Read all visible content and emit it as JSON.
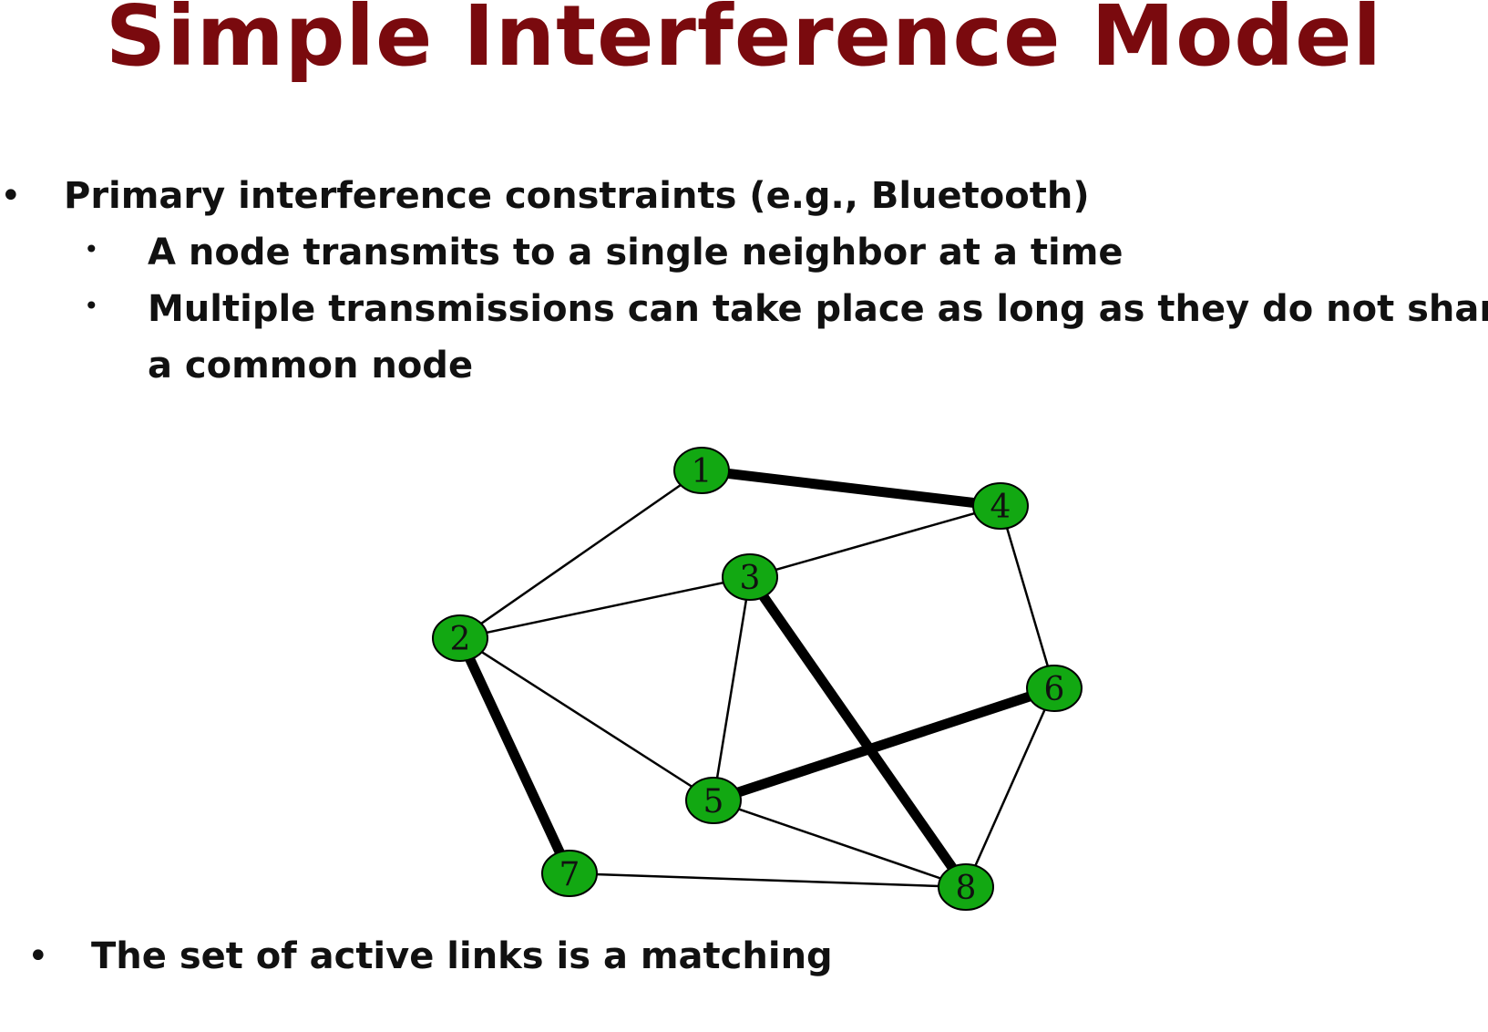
{
  "slide": {
    "title": "Simple Interference Model",
    "bullets": [
      {
        "text": "Primary interference constraints (e.g., Bluetooth)"
      },
      {
        "text": "A node transmits to a single neighbor at a time"
      },
      {
        "text": "Multiple transmissions can take place as long as they do not share"
      },
      {
        "text": "a common node"
      },
      {
        "text": "The set of active links is a matching"
      }
    ]
  },
  "graph": {
    "node_color": "#12a812",
    "nodes": [
      "1",
      "2",
      "3",
      "4",
      "5",
      "6",
      "7",
      "8"
    ],
    "edges": [
      {
        "from": "1",
        "to": "4",
        "active": true
      },
      {
        "from": "1",
        "to": "2",
        "active": false
      },
      {
        "from": "2",
        "to": "3",
        "active": false
      },
      {
        "from": "3",
        "to": "4",
        "active": false
      },
      {
        "from": "4",
        "to": "6",
        "active": false
      },
      {
        "from": "2",
        "to": "5",
        "active": false
      },
      {
        "from": "2",
        "to": "7",
        "active": true
      },
      {
        "from": "3",
        "to": "5",
        "active": false
      },
      {
        "from": "3",
        "to": "8",
        "active": true
      },
      {
        "from": "5",
        "to": "6",
        "active": true
      },
      {
        "from": "5",
        "to": "8",
        "active": false
      },
      {
        "from": "6",
        "to": "8",
        "active": false
      },
      {
        "from": "7",
        "to": "8",
        "active": false
      }
    ]
  }
}
